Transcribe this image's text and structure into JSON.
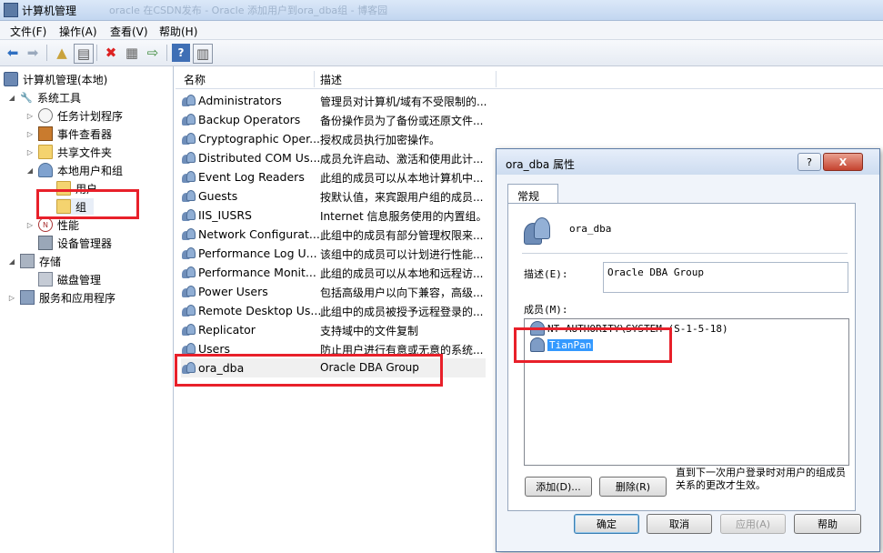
{
  "window": {
    "title": "计算机管理",
    "ghost_title": "oracle 在CSDN发布 - Oracle 添加用户到ora_dba组 - 博客园"
  },
  "menubar": [
    "文件(F)",
    "操作(A)",
    "查看(V)",
    "帮助(H)"
  ],
  "toolbar": {
    "icons": [
      "back-arrow-icon",
      "forward-arrow-icon",
      "up-folder-icon",
      "show-hide-tree-icon",
      "delete-icon",
      "properties-icon",
      "export-icon",
      "help-icon",
      "action-pane-icon"
    ]
  },
  "tree": {
    "root": "计算机管理(本地)",
    "system_tools": "系统工具",
    "task_scheduler": "任务计划程序",
    "event_viewer": "事件查看器",
    "shared_folders": "共享文件夹",
    "local_users_groups": "本地用户和组",
    "users": "用户",
    "groups": "组",
    "performance": "性能",
    "device_manager": "设备管理器",
    "storage": "存储",
    "disk_management": "磁盘管理",
    "services_apps": "服务和应用程序"
  },
  "list": {
    "col_name": "名称",
    "col_desc": "描述",
    "rows": [
      {
        "name": "Administrators",
        "desc": "管理员对计算机/域有不受限制的..."
      },
      {
        "name": "Backup Operators",
        "desc": "备份操作员为了备份或还原文件..."
      },
      {
        "name": "Cryptographic Oper...",
        "desc": "授权成员执行加密操作。"
      },
      {
        "name": "Distributed COM Us...",
        "desc": "成员允许启动、激活和使用此计..."
      },
      {
        "name": "Event Log Readers",
        "desc": "此组的成员可以从本地计算机中..."
      },
      {
        "name": "Guests",
        "desc": "按默认值，来宾跟用户组的成员..."
      },
      {
        "name": "IIS_IUSRS",
        "desc": "Internet 信息服务使用的内置组。"
      },
      {
        "name": "Network Configurat...",
        "desc": "此组中的成员有部分管理权限来..."
      },
      {
        "name": "Performance Log U...",
        "desc": "该组中的成员可以计划进行性能..."
      },
      {
        "name": "Performance Monit...",
        "desc": "此组的成员可以从本地和远程访..."
      },
      {
        "name": "Power Users",
        "desc": "包括高级用户以向下兼容，高级..."
      },
      {
        "name": "Remote Desktop Us...",
        "desc": "此组中的成员被授予远程登录的..."
      },
      {
        "name": "Replicator",
        "desc": "支持域中的文件复制"
      },
      {
        "name": "Users",
        "desc": "防止用户进行有意或无意的系统..."
      },
      {
        "name": "ora_dba",
        "desc": "Oracle DBA Group"
      }
    ]
  },
  "dialog": {
    "title": "ora_dba 属性",
    "help_btn": "?",
    "close_btn": "X",
    "tab": "常规",
    "group_name": "ora_dba",
    "desc_label": "描述(E):",
    "desc_value": "Oracle DBA Group",
    "members_label": "成员(M):",
    "members": [
      "NT AUTHORITY\\SYSTEM (S-1-5-18)",
      "TianPan"
    ],
    "add_btn": "添加(D)...",
    "remove_btn": "删除(R)",
    "note": "直到下一次用户登录时对用户的组成员关系的更改才生效。",
    "ok_btn": "确定",
    "cancel_btn": "取消",
    "apply_btn": "应用(A)",
    "help2_btn": "帮助"
  },
  "colors": {
    "highlight_red": "#e8202a",
    "selection_blue": "#3399ff"
  }
}
